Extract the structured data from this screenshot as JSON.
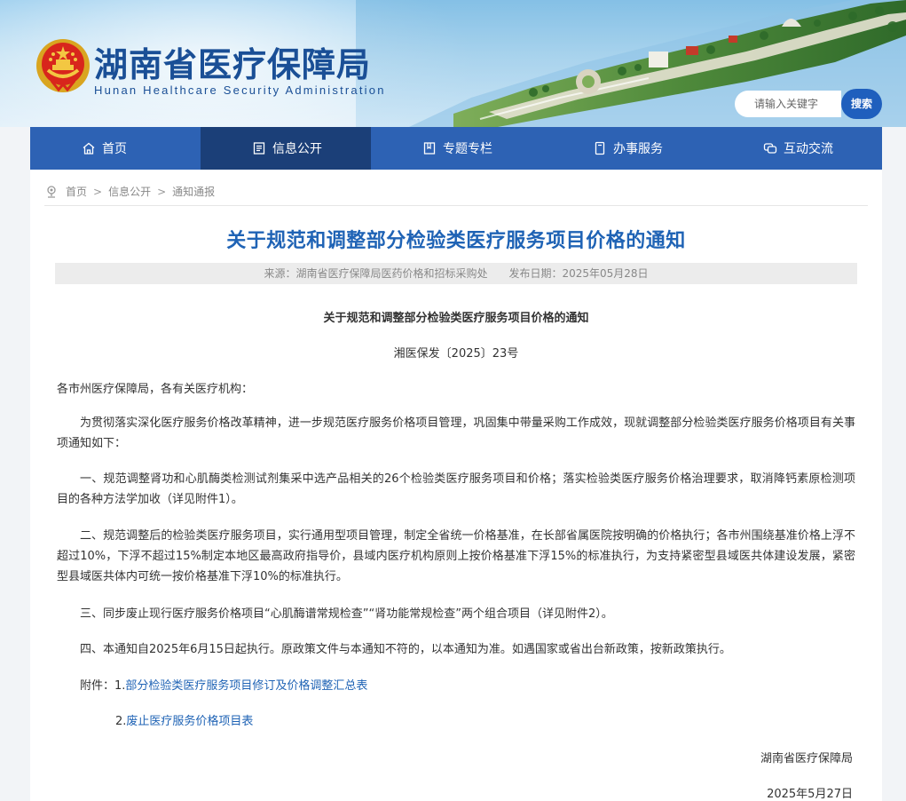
{
  "header": {
    "title": "湖南省医疗保障局",
    "subtitle": "Hunan Healthcare Security Administration",
    "emblem_icon": "national-emblem-icon",
    "search_placeholder": "请输入关键字",
    "search_button": "搜索"
  },
  "nav": {
    "items": [
      {
        "label": "首页",
        "icon": "home-icon"
      },
      {
        "label": "信息公开",
        "icon": "document-list-icon",
        "active": true
      },
      {
        "label": "专题专栏",
        "icon": "book-icon"
      },
      {
        "label": "办事服务",
        "icon": "file-icon"
      },
      {
        "label": "互动交流",
        "icon": "chat-icon"
      }
    ],
    "color": "#2d62b4",
    "active_color": "#1b3f78"
  },
  "breadcrumb": {
    "icon": "location-pin-icon",
    "items": [
      "首页",
      "信息公开",
      "通知通报"
    ],
    "separator": ">"
  },
  "article": {
    "title": "关于规范和调整部分检验类医疗服务项目价格的通知",
    "source": "来源：湖南省医疗保障局医药价格和招标采购处",
    "publish_date": "发布日期：2025年05月28日",
    "inner_title": "关于规范和调整部分检验类医疗服务项目价格的通知",
    "doc_number": "湘医保发〔2025〕23号",
    "salutation": "各市州医疗保障局，各有关医疗机构：",
    "paragraphs": [
      "为贯彻落实深化医疗服务价格改革精神，进一步规范医疗服务价格项目管理，巩固集中带量采购工作成效，现就调整部分检验类医疗服务价格项目有关事项通知如下：",
      "一、规范调整肾功和心肌酶类检测试剂集采中选产品相关的26个检验类医疗服务项目和价格；落实检验类医疗服务价格治理要求，取消降钙素原检测项目的各种方法学加收（详见附件1）。",
      "二、规范调整后的检验类医疗服务项目，实行通用型项目管理，制定全省统一价格基准，在长部省属医院按明确的价格执行；各市州围绕基准价格上浮不超过10%，下浮不超过15%制定本地区最高政府指导价，县域内医疗机构原则上按价格基准下浮15%的标准执行，为支持紧密型县域医共体建设发展，紧密型县域医共体内可统一按价格基准下浮10%的标准执行。",
      "三、同步废止现行医疗服务价格项目“心肌酶谱常规检查”“肾功能常规检查”两个组合项目（详见附件2）。",
      "四、本通知自2025年6月15日起执行。原政策文件与本通知不符的，以本通知为准。如遇国家或省出台新政策，按新政策执行。"
    ],
    "attachments_label": "附件：",
    "attachments": [
      {
        "num": "1.",
        "title": "部分检验类医疗服务项目修订及价格调整汇总表"
      },
      {
        "num": "2.",
        "title": "废止医疗服务价格项目表"
      }
    ],
    "signature": "湖南省医疗保障局",
    "sign_date": "2025年5月27日"
  },
  "colors": {
    "title_blue": "#1f63b5",
    "brand_blue": "#1a4f96",
    "search_button": "#1f5fbd"
  }
}
